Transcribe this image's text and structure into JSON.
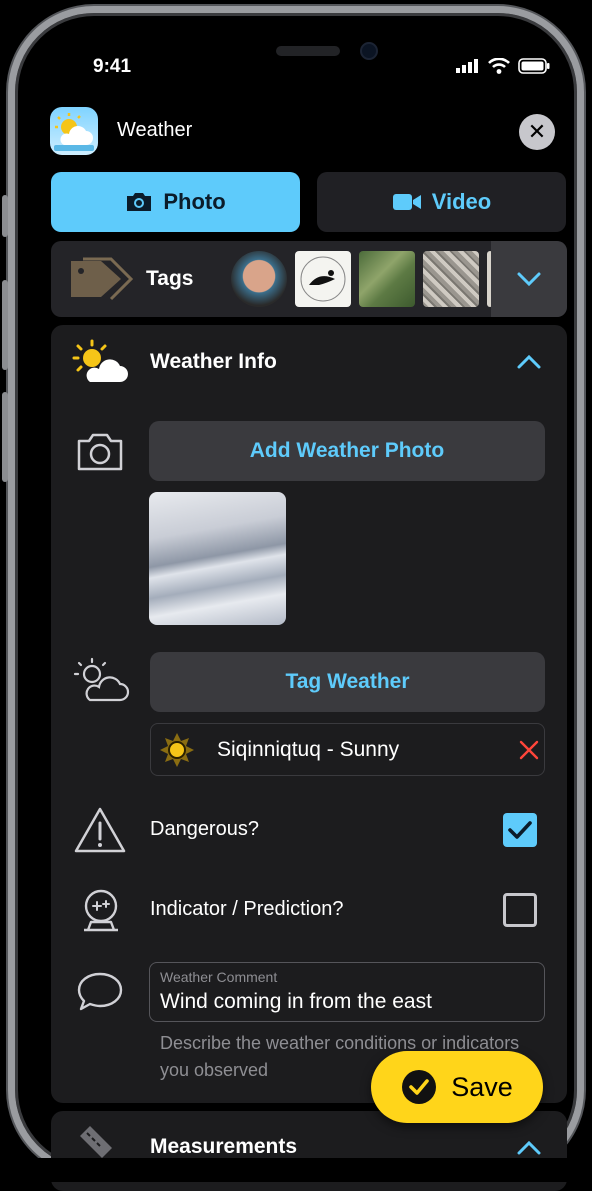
{
  "status_bar": {
    "time": "9:41"
  },
  "header": {
    "title": "Weather",
    "close_icon": "close-icon"
  },
  "media_tabs": [
    {
      "label": "Photo",
      "icon": "camera-icon",
      "selected": true
    },
    {
      "label": "Video",
      "icon": "video-camera-icon",
      "selected": false
    }
  ],
  "tags": {
    "label": "Tags",
    "icon": "tag-icon",
    "expand_icon": "chevron-down-icon"
  },
  "weather_info": {
    "title": "Weather Info",
    "add_photo_label": "Add Weather Photo",
    "tag_weather_label": "Tag Weather",
    "tagged_weather": "Siqinniqtuq - Sunny",
    "dangerous_label": "Dangerous?",
    "dangerous_checked": true,
    "indicator_label": "Indicator / Prediction?",
    "indicator_checked": false,
    "comment_label": "Weather Comment",
    "comment_value": "Wind coming in from the east",
    "comment_helper": "Describe the weather conditions or indicators you observed"
  },
  "save_button": {
    "label": "Save"
  },
  "measurements": {
    "title": "Measurements"
  },
  "colors": {
    "accent": "#5ecbfb",
    "save": "#ffd51a",
    "danger": "#ff453a",
    "card": "#1c1c1e"
  }
}
